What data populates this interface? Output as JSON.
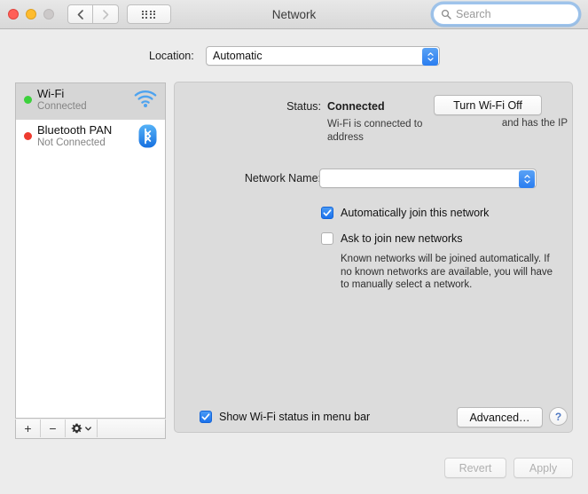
{
  "window": {
    "title": "Network",
    "traffic_lights": [
      "close-red",
      "minimize-yellow",
      "zoom-disabled"
    ],
    "back_label": "‹",
    "forward_label": "›"
  },
  "search": {
    "placeholder": "Search",
    "value": "",
    "icon": "search-icon"
  },
  "location": {
    "label": "Location:",
    "value": "Automatic",
    "options": [
      "Automatic"
    ]
  },
  "sidebar": {
    "services": [
      {
        "name": "Wi-Fi",
        "status": "Connected",
        "dot": "green",
        "icon": "wifi-icon",
        "selected": true
      },
      {
        "name": "Bluetooth PAN",
        "status": "Not Connected",
        "dot": "red",
        "icon": "bluetooth-icon",
        "selected": false
      }
    ],
    "toolbar": {
      "add": "+",
      "remove": "−",
      "gear": "gear-icon"
    }
  },
  "panel": {
    "status": {
      "label": "Status:",
      "value": "Connected",
      "description": "Wi-Fi is connected to address",
      "ip_text": "and has the IP",
      "toggle_button": "Turn Wi-Fi Off"
    },
    "network_name": {
      "label": "Network Name:",
      "value": "",
      "options": []
    },
    "checkboxes": [
      {
        "label": "Automatically join this network",
        "checked": true
      },
      {
        "label": "Ask to join new networks",
        "checked": false
      }
    ],
    "hint": "Known networks will be joined automatically. If no known networks are available, you will have to manually select a network.",
    "menubar_checkbox": {
      "label": "Show Wi-Fi status in menu bar",
      "checked": true
    },
    "advanced_button": "Advanced…",
    "help_button": "?"
  },
  "footer": {
    "revert": "Revert",
    "apply": "Apply",
    "revert_enabled": false,
    "apply_enabled": false
  },
  "colors": {
    "accent": "#1b72ec",
    "green": "#3cd13c",
    "red": "#ee3b2f",
    "window_bg": "#ececec",
    "panel_bg": "#dcdcdc"
  }
}
